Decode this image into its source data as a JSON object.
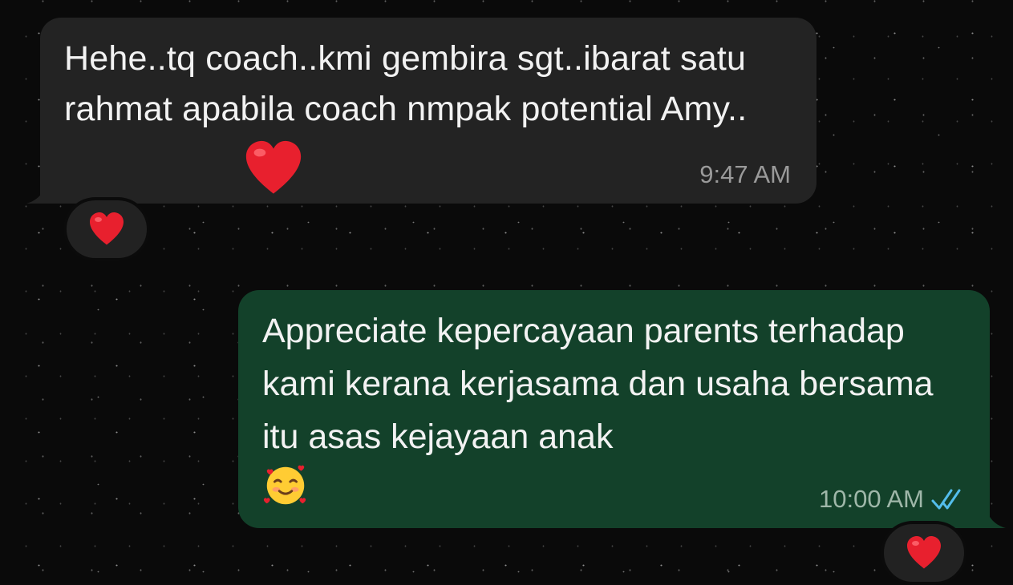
{
  "messages": [
    {
      "direction": "incoming",
      "text": "Hehe..tq coach..kmi gembira sgt..ibarat satu rahmat apabila coach nmpak potential Amy..",
      "time": "9:47 AM",
      "reaction": "red-heart"
    },
    {
      "direction": "outgoing",
      "text": "Appreciate kepercayaan parents terhadap kami kerana kerjasama dan usaha bersama itu asas kejayaan anak",
      "emoji": "smiling-face-with-hearts",
      "time": "10:00 AM",
      "status": "read",
      "reaction": "red-heart"
    }
  ],
  "colors": {
    "incoming_bubble": "#232323",
    "outgoing_bubble": "#13412a",
    "read_ticks": "#53bdeb",
    "heart": "#e8202e"
  }
}
